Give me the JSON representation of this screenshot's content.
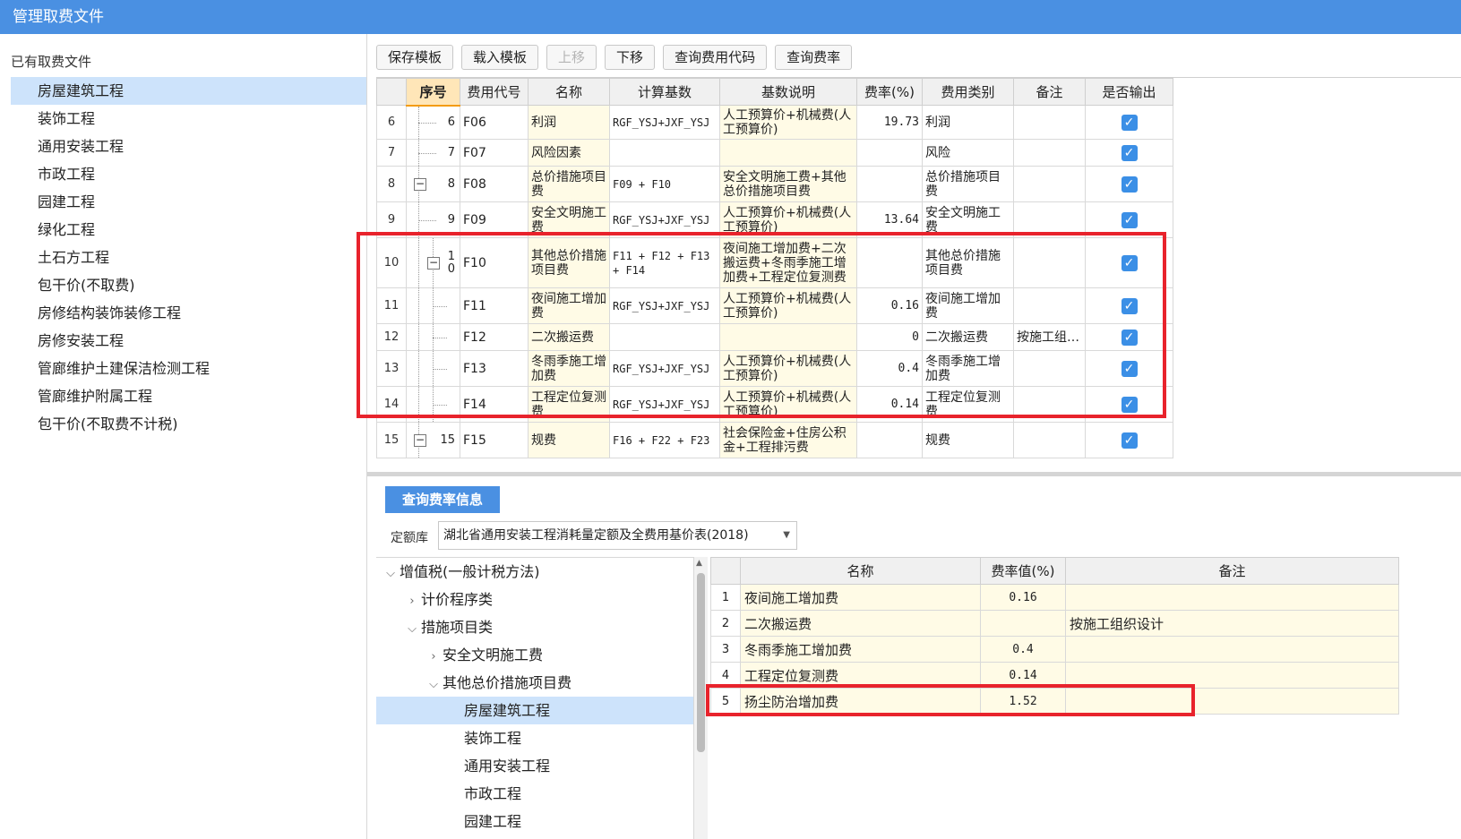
{
  "window": {
    "title": "管理取费文件"
  },
  "left": {
    "header": "已有取费文件",
    "items": [
      {
        "label": "房屋建筑工程",
        "active": true
      },
      {
        "label": "装饰工程"
      },
      {
        "label": "通用安装工程"
      },
      {
        "label": "市政工程"
      },
      {
        "label": "园建工程"
      },
      {
        "label": "绿化工程"
      },
      {
        "label": "土石方工程"
      },
      {
        "label": "包干价(不取费)"
      },
      {
        "label": "房修结构装饰装修工程"
      },
      {
        "label": "房修安装工程"
      },
      {
        "label": "管廊维护土建保洁检测工程"
      },
      {
        "label": "管廊维护附属工程"
      },
      {
        "label": "包干价(不取费不计税)"
      }
    ]
  },
  "toolbar": {
    "save_template": "保存模板",
    "load_template": "载入模板",
    "move_up": "上移",
    "move_down": "下移",
    "query_code": "查询费用代码",
    "query_rate": "查询费率"
  },
  "grid": {
    "headers": [
      "序号",
      "费用代号",
      "名称",
      "计算基数",
      "基数说明",
      "费率(%)",
      "费用类别",
      "备注",
      "是否输出"
    ],
    "rows": [
      {
        "row": "6",
        "seq": "6",
        "code": "F06",
        "name": "利润",
        "base": "RGF_YSJ+JXF_YSJ",
        "desc": "人工预算价+机械费(人工预算价)",
        "rate": "19.73",
        "type": "利润",
        "note": "",
        "output": true
      },
      {
        "row": "7",
        "seq": "7",
        "code": "F07",
        "name": "风险因素",
        "base": "",
        "desc": "",
        "rate": "",
        "type": "风险",
        "note": "",
        "output": true
      },
      {
        "row": "8",
        "seq": "8",
        "code": "F08",
        "name": "总价措施项目费",
        "base": "F09 + F10",
        "desc": "安全文明施工费+其他总价措施项目费",
        "rate": "",
        "type": "总价措施项目费",
        "note": "",
        "output": true
      },
      {
        "row": "9",
        "seq": "9",
        "code": "F09",
        "name": "安全文明施工费",
        "base": "RGF_YSJ+JXF_YSJ",
        "desc": "人工预算价+机械费(人工预算价)",
        "rate": "13.64",
        "type": "安全文明施工费",
        "note": "",
        "output": true
      },
      {
        "row": "10",
        "seq": "1\n0",
        "code": "F10",
        "name": "其他总价措施项目费",
        "base": "F11 + F12 + F13 + F14",
        "desc": "夜间施工增加费+二次搬运费+冬雨季施工增加费+工程定位复测费",
        "rate": "",
        "type": "其他总价措施项目费",
        "note": "",
        "output": true
      },
      {
        "row": "11",
        "seq": "",
        "code": "F11",
        "name": "夜间施工增加费",
        "base": "RGF_YSJ+JXF_YSJ",
        "desc": "人工预算价+机械费(人工预算价)",
        "rate": "0.16",
        "type": "夜间施工增加费",
        "note": "",
        "output": true
      },
      {
        "row": "12",
        "seq": "",
        "code": "F12",
        "name": "二次搬运费",
        "base": "",
        "desc": "",
        "rate": "0",
        "type": "二次搬运费",
        "note": "按施工组…",
        "output": true
      },
      {
        "row": "13",
        "seq": "",
        "code": "F13",
        "name": "冬雨季施工增加费",
        "base": "RGF_YSJ+JXF_YSJ",
        "desc": "人工预算价+机械费(人工预算价)",
        "rate": "0.4",
        "type": "冬雨季施工增加费",
        "note": "",
        "output": true
      },
      {
        "row": "14",
        "seq": "",
        "code": "F14",
        "name": "工程定位复测费",
        "base": "RGF_YSJ+JXF_YSJ",
        "desc": "人工预算价+机械费(人工预算价)",
        "rate": "0.14",
        "type": "工程定位复测费",
        "note": "",
        "output": true
      },
      {
        "row": "15",
        "seq": "15",
        "code": "F15",
        "name": "规费",
        "base": "F16 + F22 + F23",
        "desc": "社会保险金+住房公积金+工程排污费",
        "rate": "",
        "type": "规费",
        "note": "",
        "output": true
      }
    ]
  },
  "lower": {
    "tab_label": "查询费率信息",
    "quota_label": "定额库",
    "quota_value": "湖北省通用安装工程消耗量定额及全费用基价表(2018)",
    "tree": [
      {
        "label": "增值税(一般计税方法)",
        "arrow": "down",
        "level": 0
      },
      {
        "label": "计价程序类",
        "arrow": "right",
        "level": 1
      },
      {
        "label": "措施项目类",
        "arrow": "down",
        "level": 1
      },
      {
        "label": "安全文明施工费",
        "arrow": "right",
        "level": 2
      },
      {
        "label": "其他总价措施项目费",
        "arrow": "down",
        "level": 2
      },
      {
        "label": "房屋建筑工程",
        "arrow": "",
        "level": 3,
        "active": true
      },
      {
        "label": "装饰工程",
        "arrow": "",
        "level": 3
      },
      {
        "label": "通用安装工程",
        "arrow": "",
        "level": 3
      },
      {
        "label": "市政工程",
        "arrow": "",
        "level": 3
      },
      {
        "label": "园建工程",
        "arrow": "",
        "level": 3
      }
    ],
    "rate_headers": [
      "名称",
      "费率值(%)",
      "备注"
    ],
    "rate_rows": [
      {
        "row": "1",
        "name": "夜间施工增加费",
        "value": "0.16",
        "note": ""
      },
      {
        "row": "2",
        "name": "二次搬运费",
        "value": "",
        "note": "按施工组织设计"
      },
      {
        "row": "3",
        "name": "冬雨季施工增加费",
        "value": "0.4",
        "note": ""
      },
      {
        "row": "4",
        "name": "工程定位复测费",
        "value": "0.14",
        "note": ""
      },
      {
        "row": "5",
        "name": "扬尘防治增加费",
        "value": "1.52",
        "note": ""
      }
    ]
  },
  "colors": {
    "accent": "#4a90e2",
    "highlight_box": "#e8232c",
    "selected_bg": "#cde3fb"
  }
}
